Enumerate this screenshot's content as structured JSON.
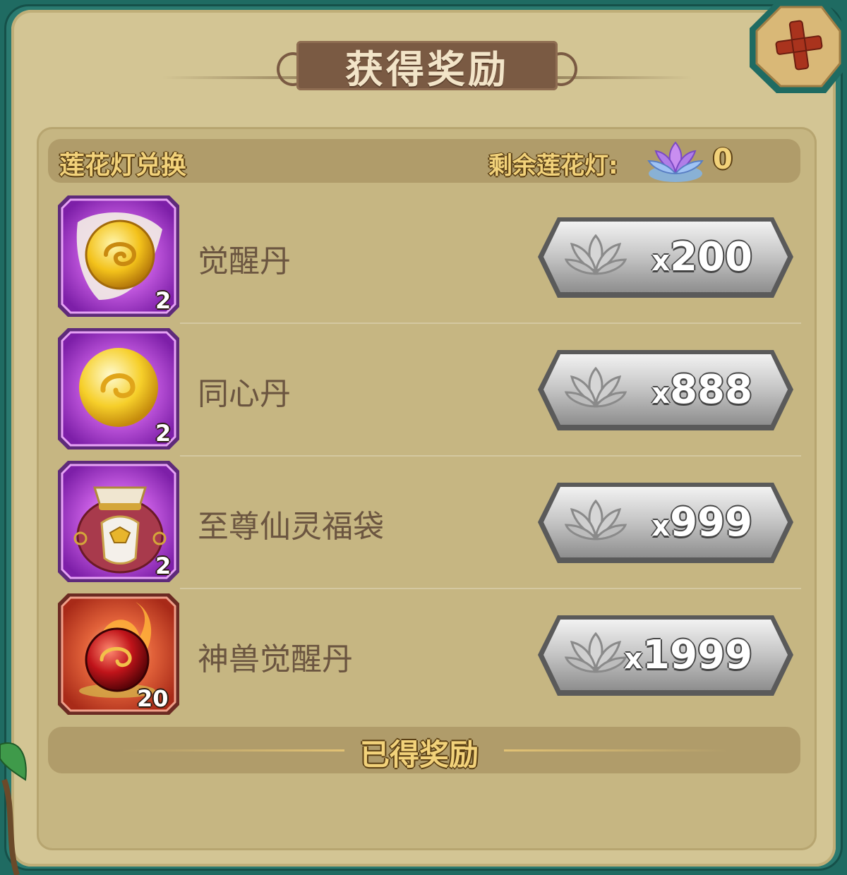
{
  "dialog": {
    "title": "获得奖励",
    "close_icon": "close-x-icon"
  },
  "header": {
    "exchange_label": "莲花灯兑换",
    "remaining_label": "剩余莲花灯:",
    "remaining_icon": "lotus-lamp-icon",
    "remaining_count": "0"
  },
  "items": [
    {
      "name": "觉醒丹",
      "icon": "golden-swirl-orb-icon",
      "count": "2",
      "cost_prefix": "x",
      "cost": "200"
    },
    {
      "name": "同心丹",
      "icon": "golden-orb-icon",
      "count": "2",
      "cost_prefix": "x",
      "cost": "888"
    },
    {
      "name": "至尊仙灵福袋",
      "icon": "lucky-bag-icon",
      "count": "2",
      "cost_prefix": "x",
      "cost": "999"
    },
    {
      "name": "神兽觉醒丹",
      "icon": "red-fire-orb-icon",
      "count": "20",
      "cost_prefix": "x",
      "cost": "1999"
    }
  ],
  "footer": {
    "obtained_label": "已得奖励"
  },
  "colors": {
    "frame": "#2a7a70",
    "panel": "#d3c594",
    "title_banner": "#7a5a43",
    "gold_text": "#f2d27a",
    "item_name": "#6b5540",
    "purple_frame": "#b04fd0",
    "red_frame": "#d0553a"
  }
}
